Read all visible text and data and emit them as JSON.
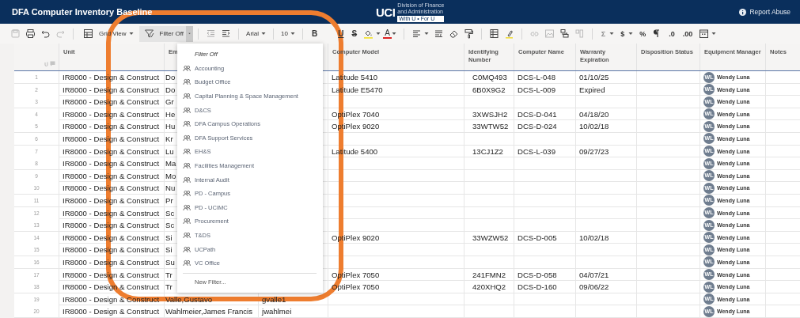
{
  "window": {
    "title": "DFA Computer Inventory Baseline",
    "logo": {
      "mark": "UCI",
      "line_1": "Division of Finance",
      "line_2": "and Administration",
      "tagline": "With U • For U"
    },
    "report_link": "Report Abuse"
  },
  "toolbar": {
    "view": "Grid View",
    "filter": "Filter Off",
    "font": "Arial",
    "font_size": "10",
    "style_glyphs": [
      "B",
      "U",
      "S"
    ],
    "text_color": "A",
    "number_glyphs": [
      {
        "text": "Σ",
        "disabled": true
      },
      {
        "text": "$",
        "disabled": false
      },
      {
        "text": "%",
        "disabled": false
      },
      {
        "text": ".0",
        "disabled": false
      },
      {
        "text": ".00",
        "disabled": false
      }
    ]
  },
  "columns": {
    "unit": "Unit",
    "employee": "Em",
    "computer_model": "Computer Model",
    "identifying_number": "Identifying Number",
    "computer_name": "Computer Name",
    "warranty_expiration": "Warranty Expiration",
    "disposition_status": "Disposition Status",
    "equipment_manager": "Equipment Manager",
    "notes": "Notes"
  },
  "rows": [
    {
      "number": "1",
      "unit": "IR8000 - Design & Construct",
      "employee": "Do",
      "computer_model": "Latitude 5410",
      "identifying_number": "C0MQ493",
      "computer_name": "DCS-L-048",
      "warranty_expiration": "01/10/25",
      "equipment_manager": {
        "initials": "WL",
        "name": "Wendy Luna"
      }
    },
    {
      "number": "2",
      "unit": "IR8000 - Design & Construct",
      "employee": "Do",
      "computer_model": "Latitude E5470",
      "identifying_number": "6B0X9G2",
      "computer_name": "DCS-L-009",
      "warranty_expiration": "Expired",
      "equipment_manager": {
        "initials": "WL",
        "name": "Wendy Luna"
      }
    },
    {
      "number": "3",
      "unit": "IR8000 - Design & Construct",
      "employee": "Gr",
      "equipment_manager": {
        "initials": "WL",
        "name": "Wendy Luna"
      }
    },
    {
      "number": "4",
      "unit": "IR8000 - Design & Construct",
      "employee": "He",
      "computer_model": "OptiPlex 7040",
      "identifying_number": "3XWSJH2",
      "computer_name": "DCS-D-041",
      "warranty_expiration": "04/18/20",
      "equipment_manager": {
        "initials": "WL",
        "name": "Wendy Luna"
      }
    },
    {
      "number": "5",
      "unit": "IR8000 - Design & Construct",
      "employee": "Hu",
      "computer_model": "OptiPlex 9020",
      "identifying_number": "33WTW52",
      "computer_name": "DCS-D-024",
      "warranty_expiration": "10/02/18",
      "equipment_manager": {
        "initials": "WL",
        "name": "Wendy Luna"
      }
    },
    {
      "number": "6",
      "unit": "IR8000 - Design & Construct",
      "employee": "Kr",
      "equipment_manager": {
        "initials": "WL",
        "name": "Wendy Luna"
      }
    },
    {
      "number": "7",
      "unit": "IR8000 - Design & Construct",
      "employee": "Lu",
      "computer_model": "Latitude 5400",
      "identifying_number": "13CJ1Z2",
      "computer_name": "DCS-L-039",
      "warranty_expiration": "09/27/23",
      "equipment_manager": {
        "initials": "WL",
        "name": "Wendy Luna"
      }
    },
    {
      "number": "8",
      "unit": "IR8000 - Design & Construct",
      "employee": "Ma",
      "equipment_manager": {
        "initials": "WL",
        "name": "Wendy Luna"
      }
    },
    {
      "number": "9",
      "unit": "IR8000 - Design & Construct",
      "employee": "Mo",
      "equipment_manager": {
        "initials": "WL",
        "name": "Wendy Luna"
      }
    },
    {
      "number": "10",
      "unit": "IR8000 - Design & Construct",
      "employee": "Nu",
      "equipment_manager": {
        "initials": "WL",
        "name": "Wendy Luna"
      }
    },
    {
      "number": "11",
      "unit": "IR8000 - Design & Construct",
      "employee": "Pr",
      "equipment_manager": {
        "initials": "WL",
        "name": "Wendy Luna"
      }
    },
    {
      "number": "12",
      "unit": "IR8000 - Design & Construct",
      "employee": "Sc",
      "equipment_manager": {
        "initials": "WL",
        "name": "Wendy Luna"
      }
    },
    {
      "number": "13",
      "unit": "IR8000 - Design & Construct",
      "employee": "Sc",
      "equipment_manager": {
        "initials": "WL",
        "name": "Wendy Luna"
      }
    },
    {
      "number": "14",
      "unit": "IR8000 - Design & Construct",
      "employee": "Si",
      "computer_model": "OptiPlex 9020",
      "identifying_number": "33WZW52",
      "computer_name": "DCS-D-005",
      "warranty_expiration": "10/02/18",
      "equipment_manager": {
        "initials": "WL",
        "name": "Wendy Luna"
      }
    },
    {
      "number": "15",
      "unit": "IR8000 - Design & Construct",
      "employee": "Si",
      "equipment_manager": {
        "initials": "WL",
        "name": "Wendy Luna"
      }
    },
    {
      "number": "16",
      "unit": "IR8000 - Design & Construct",
      "employee": "Su",
      "equipment_manager": {
        "initials": "WL",
        "name": "Wendy Luna"
      }
    },
    {
      "number": "17",
      "unit": "IR8000 - Design & Construct",
      "employee": "Tr",
      "computer_model": "OptiPlex 7050",
      "identifying_number": "241FMN2",
      "computer_name": "DCS-D-058",
      "warranty_expiration": "04/07/21",
      "equipment_manager": {
        "initials": "WL",
        "name": "Wendy Luna"
      }
    },
    {
      "number": "18",
      "unit": "IR8000 - Design & Construct",
      "employee": "Tr",
      "computer_model": "OptiPlex 7050",
      "identifying_number": "420XHQ2",
      "computer_name": "DCS-D-160",
      "warranty_expiration": "09/06/22",
      "equipment_manager": {
        "initials": "WL",
        "name": "Wendy Luna"
      }
    },
    {
      "number": "19",
      "unit": "IR8000 - Design & Construct",
      "employee": "Valle,Gustavo",
      "column_3": "gvalle1",
      "equipment_manager": {
        "initials": "WL",
        "name": "Wendy Luna"
      }
    },
    {
      "number": "20",
      "unit": "IR8000 - Design & Construct",
      "employee": "Wahlmeier,James Francis",
      "column_3": "jwahlmei",
      "equipment_manager": {
        "initials": "WL",
        "name": "Wendy Luna"
      }
    }
  ],
  "filter_menu": {
    "items": [
      {
        "kind": "off",
        "label": "Filter Off"
      },
      {
        "kind": "group",
        "label": "Accounting"
      },
      {
        "kind": "group",
        "label": "Budget Office"
      },
      {
        "kind": "group",
        "label": "Capital Planning & Space Management"
      },
      {
        "kind": "group",
        "label": "D&CS"
      },
      {
        "kind": "group",
        "label": "DFA Campus Operations"
      },
      {
        "kind": "group",
        "label": "DFA Support Services"
      },
      {
        "kind": "group",
        "label": "EH&S"
      },
      {
        "kind": "group",
        "label": "Facilities Management"
      },
      {
        "kind": "group",
        "label": "Internal Audit"
      },
      {
        "kind": "group",
        "label": "PD - Campus"
      },
      {
        "kind": "group",
        "label": "PD - UCIMC"
      },
      {
        "kind": "group",
        "label": "Procurement"
      },
      {
        "kind": "group",
        "label": "T&DS"
      },
      {
        "kind": "group",
        "label": "UCPath"
      },
      {
        "kind": "group",
        "label": "VC Office"
      },
      {
        "kind": "new",
        "label": "New Filter..."
      }
    ]
  }
}
